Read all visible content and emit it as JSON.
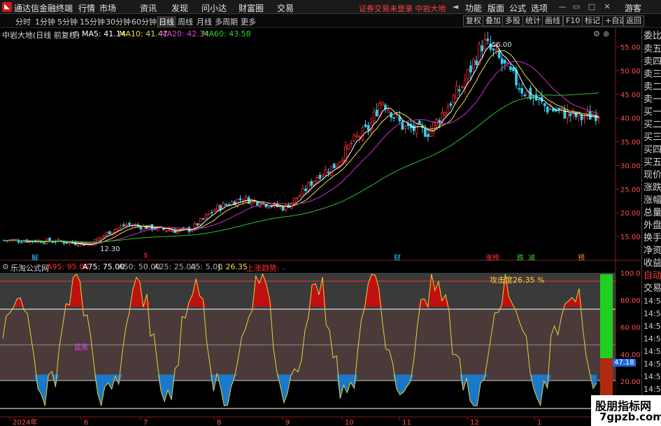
{
  "titlebar": {
    "app_title": "通达信金融终端",
    "menus": [
      "行情",
      "市场",
      "资讯",
      "发现",
      "问小达",
      "财富圈",
      "交易"
    ],
    "notice": "证券交易未登录  中岩大地",
    "right_menus": [
      "功能",
      "版面",
      "公式",
      "选项"
    ],
    "guest": "游客"
  },
  "toolbar": {
    "periods": [
      "分时",
      "1分钟",
      "5分钟",
      "15分钟",
      "30分钟",
      "60分钟",
      "日线",
      "周线",
      "月线",
      "多周期",
      "更多"
    ],
    "active_period": "日线",
    "right_buttons": [
      "复权",
      "叠加",
      "多股",
      "统计",
      "画线",
      "F10",
      "标记",
      "+自选",
      "返回"
    ]
  },
  "kline_header": {
    "stock": "中岩大地(日线 前复权)",
    "ma5": "MA5: 41.14",
    "ma10": "MA10: 41.47",
    "ma20": "MA20: 42.34",
    "ma60": "MA60: 43.58"
  },
  "indicator_header": {
    "name": "乐淘公式网",
    "a95": "A95: 95.00",
    "a75": "A75: 75.00",
    "a50": "A50: 50.00",
    "a25": "A25: 25.00",
    "a5": "A5: 5.00",
    "j": "J: 26.35",
    "signal": "上涨趋势: -"
  },
  "chart_data": {
    "type": "candlestick",
    "price_axis": [
      55.0,
      50.0,
      45.0,
      40.0,
      35.0,
      30.0,
      25.0,
      20.0,
      15.0
    ],
    "high_label": "56.00",
    "low_label": "12.30",
    "x_month_labels": [
      "2024年",
      "6",
      "7",
      "8",
      "9",
      "10",
      "11",
      "12",
      "1"
    ],
    "event_tags": [
      "解",
      "$",
      "财",
      "涨榜",
      "跌",
      "减",
      "预"
    ],
    "series": [
      {
        "name": "MA5",
        "color": "#ffffff"
      },
      {
        "name": "MA10",
        "color": "#e8e04a"
      },
      {
        "name": "MA20",
        "color": "#d030d0"
      },
      {
        "name": "MA60",
        "color": "#30c030"
      }
    ],
    "indicator": {
      "axis": [
        100.0,
        80.0,
        60.0,
        40.0,
        20.0
      ],
      "levels": [
        95,
        75,
        50,
        25,
        5
      ],
      "annotation": "攻击度26.35 %",
      "label_left": "猛黑",
      "current_value": "47.18"
    }
  },
  "right_panel": {
    "items": [
      "委比",
      "卖五",
      "卖四",
      "卖三",
      "卖二",
      "卖一",
      "买一",
      "买二",
      "买三",
      "买四",
      "买五",
      "现价",
      "涨跌",
      "涨幅",
      "总量",
      "外盘",
      "换手",
      "净资",
      "收益"
    ],
    "bottom_items": [
      "自动",
      "交易"
    ],
    "times": [
      "14:55",
      "14:55",
      "14:56",
      "14:56",
      "14:56",
      "14:56",
      "14:56",
      "14:56"
    ]
  },
  "watermark": {
    "line1": "股朋指标网",
    "line2": "7gpzb.com"
  },
  "colors": {
    "up": "#ff3030",
    "down": "#30d0f0",
    "red_fill": "#c01010",
    "blue_fill": "#1a7acc"
  }
}
